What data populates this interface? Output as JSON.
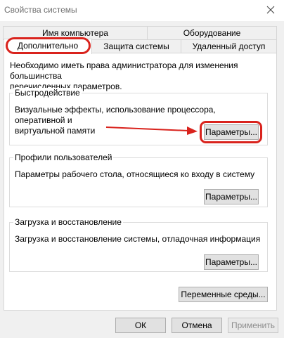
{
  "window": {
    "title": "Свойства системы"
  },
  "tabs": {
    "computer_name": "Имя компьютера",
    "hardware": "Оборудование",
    "advanced": "Дополнительно",
    "system_protection": "Защита системы",
    "remote_access": "Удаленный доступ"
  },
  "admin_note": "Необходимо иметь права администратора для изменения большинства\nперечисленных параметров.",
  "performance": {
    "title": "Быстродействие",
    "description": "Визуальные эффекты, использование процессора, оперативной и\nвиртуальной памяти",
    "button": "Параметры..."
  },
  "user_profiles": {
    "title": "Профили пользователей",
    "description": "Параметры рабочего стола, относящиеся ко входу в систему",
    "button": "Параметры..."
  },
  "startup_recovery": {
    "title": "Загрузка и восстановление",
    "description": "Загрузка и восстановление системы, отладочная информация",
    "button": "Параметры..."
  },
  "env_button": "Переменные среды...",
  "footer": {
    "ok": "ОК",
    "cancel": "Отмена",
    "apply": "Применить"
  },
  "colors": {
    "annotation_red": "#d9231d"
  },
  "icons": {
    "close": "close-icon",
    "arrow": "red-arrow-annotation"
  }
}
